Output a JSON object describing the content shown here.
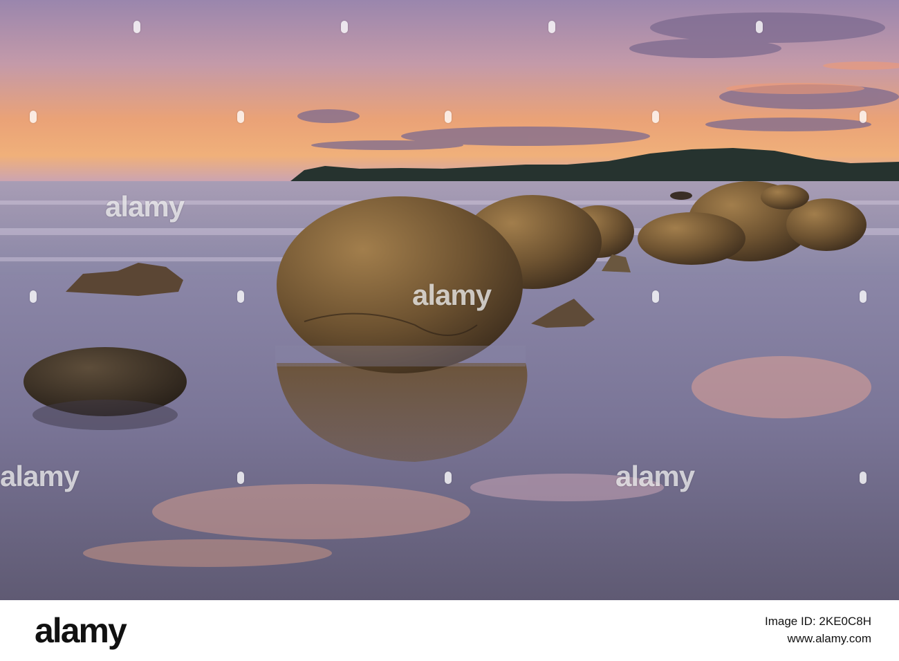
{
  "photo": {
    "subject": "Moeraki boulders on a beach at sunset",
    "colors": {
      "sky_top": "#8f7fa8",
      "sky_glow": "#f2a566",
      "sea": "#8e8aa6",
      "sand_wet": "#6f6a8c",
      "boulder": "#6b5434",
      "headland": "#1f2a2e"
    }
  },
  "watermark": {
    "text": "alamy"
  },
  "footer": {
    "logo": "alamy",
    "image_id_label": "Image ID: 2KE0C8H",
    "site": "www.alamy.com"
  }
}
